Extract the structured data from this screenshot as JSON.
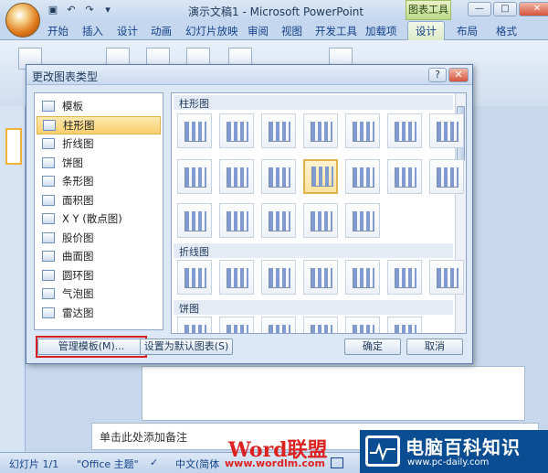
{
  "app": {
    "title": "演示文稿1 - Microsoft PowerPoint",
    "context_tab": "图表工具",
    "win_buttons": [
      "—",
      "□",
      "✕"
    ]
  },
  "ribbon_tabs": [
    "开始",
    "插入",
    "设计",
    "动画",
    "幻灯片放映",
    "审阅",
    "视图",
    "开发工具",
    "加载项",
    "设计",
    "布局",
    "格式"
  ],
  "selected_tab_index": 9,
  "dialog": {
    "title": "更改图表类型",
    "help": "?",
    "close": "✕",
    "types": [
      {
        "label": "模板",
        "icon": "folder-icon"
      },
      {
        "label": "柱形图",
        "icon": "column-chart-icon"
      },
      {
        "label": "折线图",
        "icon": "line-chart-icon"
      },
      {
        "label": "饼图",
        "icon": "pie-chart-icon"
      },
      {
        "label": "条形图",
        "icon": "bar-chart-icon"
      },
      {
        "label": "面积图",
        "icon": "area-chart-icon"
      },
      {
        "label": "X Y (散点图)",
        "icon": "scatter-chart-icon"
      },
      {
        "label": "股价图",
        "icon": "stock-chart-icon"
      },
      {
        "label": "曲面图",
        "icon": "surface-chart-icon"
      },
      {
        "label": "圆环图",
        "icon": "doughnut-chart-icon"
      },
      {
        "label": "气泡图",
        "icon": "bubble-chart-icon"
      },
      {
        "label": "雷达图",
        "icon": "radar-chart-icon"
      }
    ],
    "selected_type_index": 1,
    "gallery_sections": [
      "柱形图",
      "折线图",
      "饼图"
    ],
    "buttons": {
      "manage_templates": "管理模板(M)...",
      "set_default": "设置为默认图表(S)",
      "ok": "确定",
      "cancel": "取消"
    }
  },
  "notes_placeholder": "单击此处添加备注",
  "status": {
    "slide": "幻灯片 1/1",
    "theme": "\"Office 主题\"",
    "lang": "中文(简体"
  },
  "watermarks": {
    "site1": "Word联盟",
    "site1_url": "www.wordlm.com",
    "site2": "电脑百科知识",
    "site2_url": "www.pc-daily.com"
  }
}
